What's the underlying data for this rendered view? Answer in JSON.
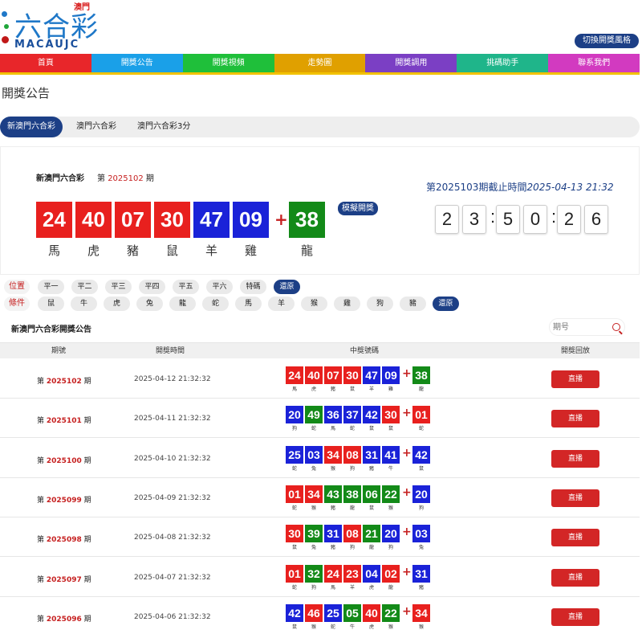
{
  "brand": {
    "name": "六合彩",
    "region": "澳門",
    "sub": "MACAUJC"
  },
  "header": {
    "switch_label": "切換開獎風格"
  },
  "nav": [
    {
      "label": "首頁",
      "color": "#e8262a"
    },
    {
      "label": "開獎公告",
      "color": "#1aa0e8"
    },
    {
      "label": "開獎視頻",
      "color": "#1fbf3a"
    },
    {
      "label": "走勢圖",
      "color": "#e0a000"
    },
    {
      "label": "開獎調用",
      "color": "#7b3fc4"
    },
    {
      "label": "挑碼助手",
      "color": "#1fb58a"
    },
    {
      "label": "聯系我們",
      "color": "#d23ac0"
    }
  ],
  "page_title": "開獎公告",
  "tabs": [
    {
      "label": "新澳門六合彩",
      "active": true
    },
    {
      "label": "澳門六合彩",
      "active": false
    },
    {
      "label": "澳門六合彩3分",
      "active": false
    }
  ],
  "current": {
    "lottery": "新澳門六合彩",
    "issue_prefix": "第",
    "issue": "2025102",
    "issue_suffix": "期",
    "balls": [
      {
        "num": "24",
        "zodiac": "馬",
        "color": "red"
      },
      {
        "num": "40",
        "zodiac": "虎",
        "color": "red"
      },
      {
        "num": "07",
        "zodiac": "豬",
        "color": "red"
      },
      {
        "num": "30",
        "zodiac": "鼠",
        "color": "red"
      },
      {
        "num": "47",
        "zodiac": "羊",
        "color": "blue"
      },
      {
        "num": "09",
        "zodiac": "雞",
        "color": "blue"
      }
    ],
    "plus": "+",
    "special": {
      "num": "38",
      "zodiac": "龍",
      "color": "green"
    },
    "simulate_label": "模擬開獎",
    "next_text": "第2025103期截止時間",
    "next_time": "2025-04-13 21:32",
    "countdown": [
      "2",
      "3",
      ":",
      "5",
      "0",
      ":",
      "2",
      "6"
    ]
  },
  "filters": {
    "position_label": "位置",
    "positions": [
      "平一",
      "平二",
      "平三",
      "平四",
      "平五",
      "平六",
      "特碼"
    ],
    "condition_label": "條件",
    "conditions": [
      "鼠",
      "牛",
      "虎",
      "兔",
      "龍",
      "蛇",
      "馬",
      "羊",
      "猴",
      "雞",
      "狗",
      "豬"
    ],
    "reset_label": "還原"
  },
  "list": {
    "title": "新澳門六合彩開獎公告",
    "search_placeholder": "期号",
    "headers": [
      "期號",
      "開獎時間",
      "中獎號碼",
      "開獎回放"
    ],
    "live_label": "直播",
    "rows": [
      {
        "issue": "2025102",
        "time": "2025-04-12 21:32:32",
        "balls": [
          [
            "24",
            "red",
            "馬"
          ],
          [
            "40",
            "red",
            "虎"
          ],
          [
            "07",
            "red",
            "豬"
          ],
          [
            "30",
            "red",
            "鼠"
          ],
          [
            "47",
            "blue",
            "羊"
          ],
          [
            "09",
            "blue",
            "雞"
          ]
        ],
        "special": [
          "38",
          "green",
          "龍"
        ]
      },
      {
        "issue": "2025101",
        "time": "2025-04-11 21:32:32",
        "balls": [
          [
            "20",
            "blue",
            "狗"
          ],
          [
            "49",
            "green",
            "蛇"
          ],
          [
            "36",
            "blue",
            "馬"
          ],
          [
            "37",
            "blue",
            "蛇"
          ],
          [
            "42",
            "blue",
            "鼠"
          ],
          [
            "30",
            "red",
            "鼠"
          ]
        ],
        "special": [
          "01",
          "red",
          "蛇"
        ]
      },
      {
        "issue": "2025100",
        "time": "2025-04-10 21:32:32",
        "balls": [
          [
            "25",
            "blue",
            "蛇"
          ],
          [
            "03",
            "blue",
            "兔"
          ],
          [
            "34",
            "red",
            "猴"
          ],
          [
            "08",
            "red",
            "狗"
          ],
          [
            "31",
            "blue",
            "豬"
          ],
          [
            "41",
            "blue",
            "牛"
          ]
        ],
        "special": [
          "42",
          "blue",
          "鼠"
        ]
      },
      {
        "issue": "2025099",
        "time": "2025-04-09 21:32:32",
        "balls": [
          [
            "01",
            "red",
            "蛇"
          ],
          [
            "34",
            "red",
            "猴"
          ],
          [
            "43",
            "green",
            "豬"
          ],
          [
            "38",
            "green",
            "龍"
          ],
          [
            "06",
            "green",
            "鼠"
          ],
          [
            "22",
            "green",
            "猴"
          ]
        ],
        "special": [
          "20",
          "blue",
          "狗"
        ]
      },
      {
        "issue": "2025098",
        "time": "2025-04-08 21:32:32",
        "balls": [
          [
            "30",
            "red",
            "鼠"
          ],
          [
            "39",
            "green",
            "兔"
          ],
          [
            "31",
            "blue",
            "豬"
          ],
          [
            "08",
            "red",
            "狗"
          ],
          [
            "21",
            "green",
            "龍"
          ],
          [
            "20",
            "blue",
            "狗"
          ]
        ],
        "special": [
          "03",
          "blue",
          "兔"
        ]
      },
      {
        "issue": "2025097",
        "time": "2025-04-07 21:32:32",
        "balls": [
          [
            "01",
            "red",
            "蛇"
          ],
          [
            "32",
            "green",
            "狗"
          ],
          [
            "24",
            "red",
            "馬"
          ],
          [
            "23",
            "red",
            "羊"
          ],
          [
            "04",
            "blue",
            "虎"
          ],
          [
            "02",
            "red",
            "龍"
          ]
        ],
        "special": [
          "31",
          "blue",
          "豬"
        ]
      },
      {
        "issue": "2025096",
        "time": "2025-04-06 21:32:32",
        "balls": [
          [
            "42",
            "blue",
            "鼠"
          ],
          [
            "46",
            "red",
            "猴"
          ],
          [
            "25",
            "blue",
            "蛇"
          ],
          [
            "05",
            "green",
            "牛"
          ],
          [
            "40",
            "red",
            "虎"
          ],
          [
            "22",
            "green",
            "猴"
          ]
        ],
        "special": [
          "34",
          "red",
          "猴"
        ]
      }
    ]
  },
  "colors": {
    "red": "#e8201e",
    "blue": "#1a22d8",
    "green": "#138a18",
    "navy": "#1c3f86"
  }
}
